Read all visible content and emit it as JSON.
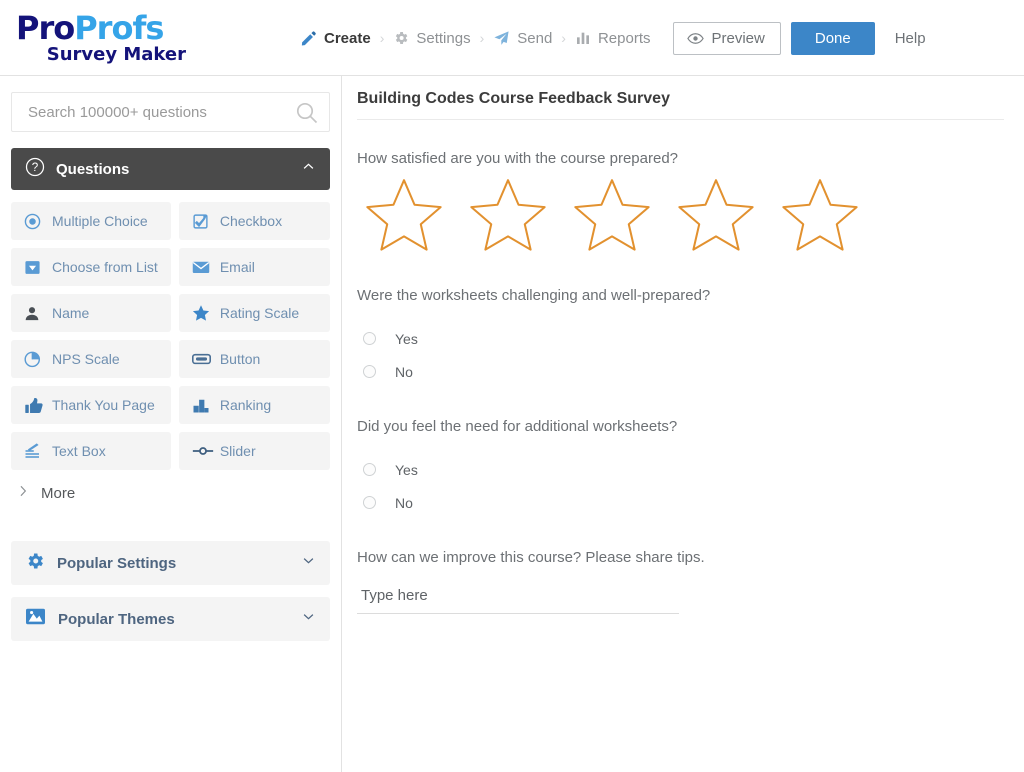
{
  "brand": {
    "name_part1": "Pro",
    "name_part2": "Profs",
    "tagline": "Survey Maker",
    "color_pro": "#14137a",
    "color_profs": "#35a4e8"
  },
  "nav": {
    "separator": "›",
    "items": [
      {
        "label": "Create",
        "icon": "pencil-icon",
        "active": true
      },
      {
        "label": "Settings",
        "icon": "gear-icon",
        "active": false
      },
      {
        "label": "Send",
        "icon": "send-icon",
        "active": false
      },
      {
        "label": "Reports",
        "icon": "bar-chart-icon",
        "active": false
      }
    ],
    "preview_label": "Preview",
    "preview_icon": "eye-icon",
    "done_label": "Done",
    "done_color": "#3c86c8",
    "help_label": "Help"
  },
  "sidebar": {
    "search": {
      "placeholder": "Search 100000+ questions",
      "value": "",
      "icon": "search-icon"
    },
    "questions_panel": {
      "label": "Questions",
      "icon": "question-mark-circle-icon",
      "chevron": "chevron-up-icon",
      "background": "#4a4a4a",
      "expanded": true
    },
    "question_types": [
      {
        "label": "Multiple Choice",
        "icon": "radio-button-icon"
      },
      {
        "label": "Checkbox",
        "icon": "checkbox-icon"
      },
      {
        "label": "Choose from List",
        "icon": "dropdown-icon"
      },
      {
        "label": "Email",
        "icon": "envelope-icon"
      },
      {
        "label": "Name",
        "icon": "person-icon"
      },
      {
        "label": "Rating Scale",
        "icon": "star-icon"
      },
      {
        "label": "NPS Scale",
        "icon": "pie-chart-icon"
      },
      {
        "label": "Button",
        "icon": "button-icon"
      },
      {
        "label": "Thank You Page",
        "icon": "thumbs-up-icon"
      },
      {
        "label": "Ranking",
        "icon": "bar-ranking-icon"
      },
      {
        "label": "Text Box",
        "icon": "text-lines-icon"
      },
      {
        "label": "Slider",
        "icon": "slider-icon"
      }
    ],
    "more": {
      "label": "More",
      "icon": "chevron-right-icon"
    },
    "popular_settings": {
      "label": "Popular Settings",
      "icon": "gear-icon",
      "chevron": "chevron-down-icon",
      "expanded": false
    },
    "popular_themes": {
      "label": "Popular Themes",
      "icon": "image-icon",
      "chevron": "chevron-down-icon",
      "expanded": false
    }
  },
  "survey": {
    "title": "Building Codes Course Feedback Survey",
    "questions": [
      {
        "type": "rating",
        "text": "How satisfied are you with the course prepared?",
        "star_count": 5,
        "stars_selected": 0,
        "star_color": "#e2912f"
      },
      {
        "type": "radio",
        "text": "Were the worksheets challenging and well-prepared?",
        "options": [
          "Yes",
          "No"
        ],
        "selected": null
      },
      {
        "type": "radio",
        "text": "Did you feel the need for additional worksheets?",
        "options": [
          "Yes",
          "No"
        ],
        "selected": null
      },
      {
        "type": "text",
        "text": "How can we improve this course? Please share tips.",
        "placeholder": "Type here",
        "value": ""
      }
    ]
  }
}
